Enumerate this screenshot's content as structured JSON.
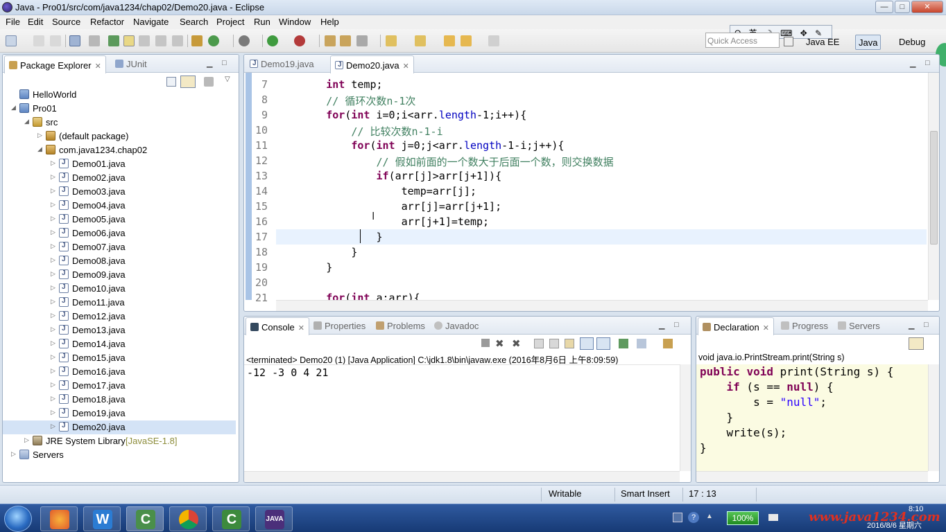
{
  "window": {
    "title": "Java - Pro01/src/com/java1234/chap02/Demo20.java - Eclipse",
    "controls": [
      "—",
      "□",
      "✕"
    ]
  },
  "menu": [
    "File",
    "Edit",
    "Source",
    "Refactor",
    "Navigate",
    "Search",
    "Project",
    "Run",
    "Window",
    "Help"
  ],
  "toolbar": {
    "quick_access": "Quick Access",
    "ime": "Q 英 ☽ ⌨ ✥ ✎",
    "perspectives": [
      "Java EE",
      "Java",
      "Debug"
    ]
  },
  "package_explorer": {
    "tabs": [
      "Package Explorer",
      "JUnit"
    ],
    "tree": [
      {
        "label": "HelloWorld",
        "icon": "project-icon",
        "depth": 0,
        "arrow": ""
      },
      {
        "label": "Pro01",
        "icon": "project-icon",
        "depth": 0,
        "arrow": "◢"
      },
      {
        "label": "src",
        "icon": "src-folder-icon",
        "depth": 1,
        "arrow": "◢"
      },
      {
        "label": "(default package)",
        "icon": "package-icon",
        "depth": 2,
        "arrow": "▷"
      },
      {
        "label": "com.java1234.chap02",
        "icon": "package-icon",
        "depth": 2,
        "arrow": "◢"
      },
      {
        "label": "Demo01.java",
        "icon": "java-file-icon",
        "depth": 3,
        "arrow": "▷"
      },
      {
        "label": "Demo02.java",
        "icon": "java-file-icon",
        "depth": 3,
        "arrow": "▷"
      },
      {
        "label": "Demo03.java",
        "icon": "java-file-icon",
        "depth": 3,
        "arrow": "▷"
      },
      {
        "label": "Demo04.java",
        "icon": "java-file-icon",
        "depth": 3,
        "arrow": "▷"
      },
      {
        "label": "Demo05.java",
        "icon": "java-file-icon",
        "depth": 3,
        "arrow": "▷"
      },
      {
        "label": "Demo06.java",
        "icon": "java-file-icon",
        "depth": 3,
        "arrow": "▷"
      },
      {
        "label": "Demo07.java",
        "icon": "java-file-icon",
        "depth": 3,
        "arrow": "▷"
      },
      {
        "label": "Demo08.java",
        "icon": "java-file-icon",
        "depth": 3,
        "arrow": "▷"
      },
      {
        "label": "Demo09.java",
        "icon": "java-file-icon",
        "depth": 3,
        "arrow": "▷"
      },
      {
        "label": "Demo10.java",
        "icon": "java-file-icon",
        "depth": 3,
        "arrow": "▷"
      },
      {
        "label": "Demo11.java",
        "icon": "java-file-icon",
        "depth": 3,
        "arrow": "▷"
      },
      {
        "label": "Demo12.java",
        "icon": "java-file-icon",
        "depth": 3,
        "arrow": "▷"
      },
      {
        "label": "Demo13.java",
        "icon": "java-file-icon",
        "depth": 3,
        "arrow": "▷"
      },
      {
        "label": "Demo14.java",
        "icon": "java-file-icon",
        "depth": 3,
        "arrow": "▷"
      },
      {
        "label": "Demo15.java",
        "icon": "java-file-icon",
        "depth": 3,
        "arrow": "▷"
      },
      {
        "label": "Demo16.java",
        "icon": "java-file-icon",
        "depth": 3,
        "arrow": "▷"
      },
      {
        "label": "Demo17.java",
        "icon": "java-file-icon",
        "depth": 3,
        "arrow": "▷"
      },
      {
        "label": "Demo18.java",
        "icon": "java-file-icon",
        "depth": 3,
        "arrow": "▷"
      },
      {
        "label": "Demo19.java",
        "icon": "java-file-icon",
        "depth": 3,
        "arrow": "▷"
      },
      {
        "label": "Demo20.java",
        "icon": "java-file-icon",
        "depth": 3,
        "arrow": "▷",
        "selected": true
      },
      {
        "label": "JRE System Library",
        "suffix": "[JavaSE-1.8]",
        "icon": "library-icon",
        "depth": 1,
        "arrow": "▷"
      },
      {
        "label": "Servers",
        "icon": "folder-icon",
        "depth": 0,
        "arrow": "▷"
      }
    ]
  },
  "editor": {
    "tabs": [
      "Demo19.java",
      "Demo20.java"
    ],
    "active_tab": 1,
    "lines": [
      {
        "n": "7",
        "html": "        <span class=\"kw\">int</span> temp;"
      },
      {
        "n": "8",
        "html": "        <span class=\"cm\">// 循环次数n-1次</span>"
      },
      {
        "n": "9",
        "html": "        <span class=\"kw\">for</span>(<span class=\"kw\">int</span> i=0;i&lt;arr.<span class=\"fld\">length</span>-1;i++){"
      },
      {
        "n": "10",
        "html": "            <span class=\"cm\">// 比较次数n-1-i</span>"
      },
      {
        "n": "11",
        "html": "            <span class=\"kw\">for</span>(<span class=\"kw\">int</span> j=0;j&lt;arr.<span class=\"fld\">length</span>-1-i;j++){"
      },
      {
        "n": "12",
        "html": "                <span class=\"cm\">// 假如前面的一个数大于后面一个数，则交换数据</span>"
      },
      {
        "n": "13",
        "html": "                <span class=\"kw\">if</span>(arr[j]&gt;arr[j+1]){"
      },
      {
        "n": "14",
        "html": "                    temp=arr[j];"
      },
      {
        "n": "15",
        "html": "                    arr[j]=arr[j+1];"
      },
      {
        "n": "16",
        "html": "                    arr[j+1]=temp;"
      },
      {
        "n": "17",
        "html": "                }"
      },
      {
        "n": "18",
        "html": "            }"
      },
      {
        "n": "19",
        "html": "        }"
      },
      {
        "n": "20",
        "html": ""
      },
      {
        "n": "21",
        "html": "        <span class=\"kw\">for</span>(<span class=\"kw\">int</span> a:arr){"
      }
    ],
    "current_line_index": 10
  },
  "console": {
    "tabs": [
      "Console",
      "Properties",
      "Problems",
      "Javadoc"
    ],
    "header": "<terminated> Demo20 (1) [Java Application] C:\\jdk1.8\\bin\\javaw.exe (2016年8月6日 上午8:09:59)",
    "output": "-12 -3 0 4 21"
  },
  "declaration": {
    "tabs": [
      "Declaration",
      "Progress",
      "Servers"
    ],
    "signature": "void java.io.PrintStream.print(String s)",
    "code": [
      "<span class=\"kw\">public</span> <span class=\"kw\">void</span> print(String s) {",
      "    <span class=\"kw\">if</span> (s == <span class=\"kw\">null</span>) {",
      "        s = <span class=\"str\">\"null\"</span>;",
      "    }",
      "    write(s);",
      "}"
    ]
  },
  "status": {
    "writable": "Writable",
    "insert_mode": "Smart Insert",
    "position": "17 : 13"
  },
  "taskbar": {
    "battery": "100%",
    "watermark": "www.java1234.com",
    "clock_time": "8:10",
    "clock_date": "2016/8/6 星期六",
    "apps": [
      "start-orb",
      "media-player",
      "word",
      "intellij",
      "chrome",
      "camtasia",
      "java-ide"
    ]
  },
  "colors": {
    "accent": "#3d6bb3",
    "keyword": "#7f0055",
    "comment": "#3f7f5f",
    "field": "#0000c0",
    "string": "#2a00ff"
  }
}
